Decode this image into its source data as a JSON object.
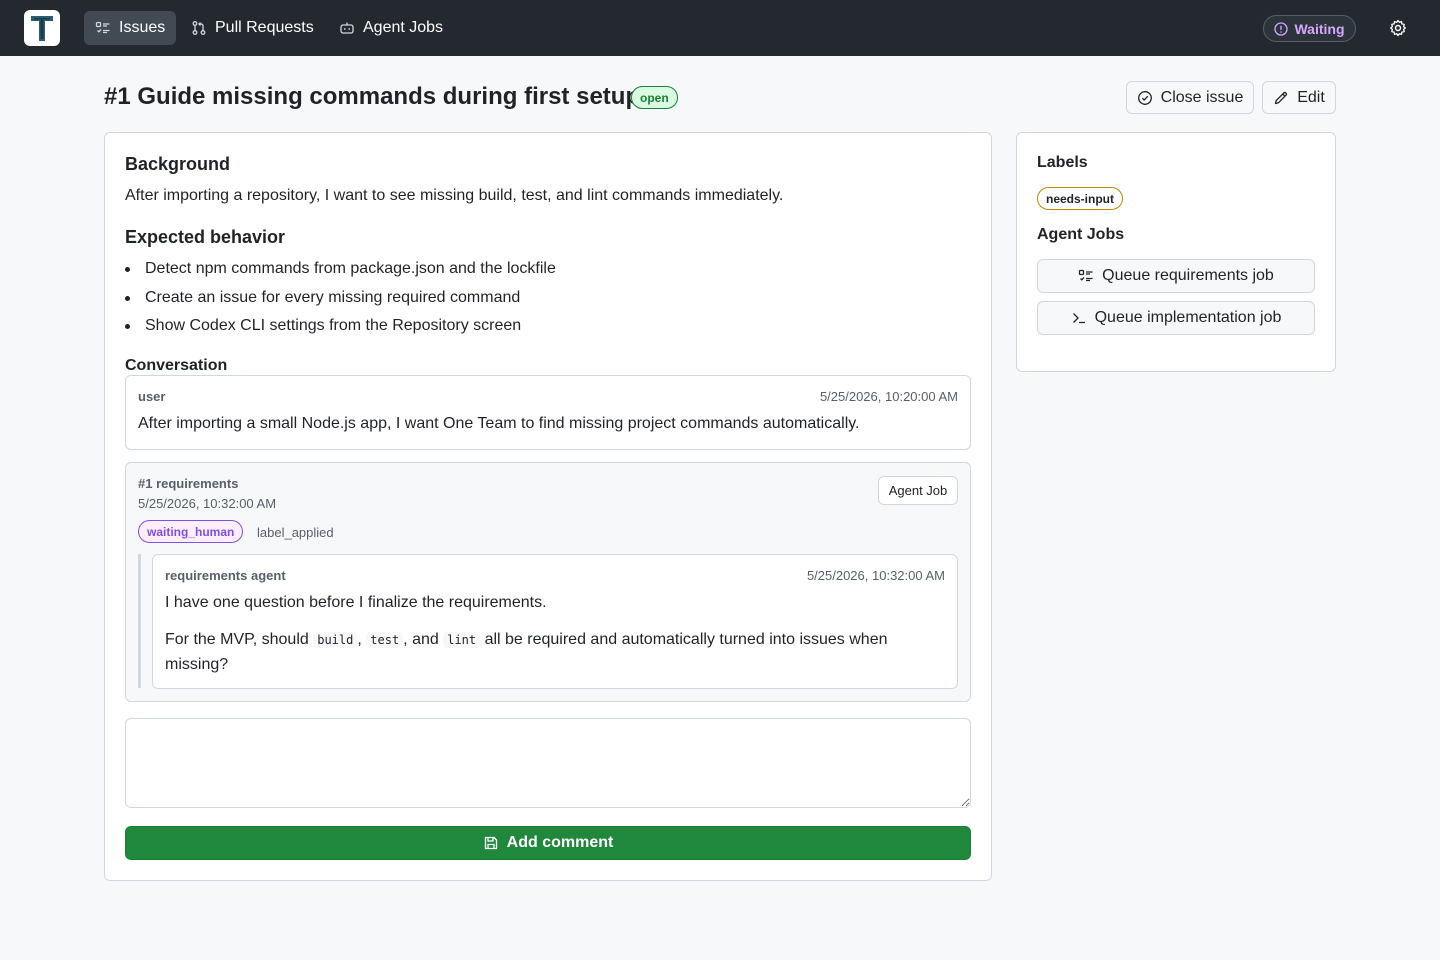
{
  "nav": {
    "items": [
      {
        "label": "Issues",
        "icon": "tasklist-icon",
        "active": true
      },
      {
        "label": "Pull Requests",
        "icon": "git-pull-request-icon",
        "active": false
      },
      {
        "label": "Agent Jobs",
        "icon": "robot-icon",
        "active": false
      }
    ],
    "status_label": "Waiting",
    "status_icon": "info-circle-icon"
  },
  "issue": {
    "title": "#1 Guide missing commands during first setup",
    "state": "open",
    "close_label": "Close issue",
    "edit_label": "Edit"
  },
  "body": {
    "background_heading": "Background",
    "background_text": "After importing a repository, I want to see missing build, test, and lint commands immediately.",
    "expected_heading": "Expected behavior",
    "expected_items": [
      "Detect npm commands from package.json and the lockfile",
      "Create an issue for every missing required command",
      "Show Codex CLI settings from the Repository screen"
    ]
  },
  "conversation": {
    "heading": "Conversation",
    "user_comment": {
      "author": "user",
      "timestamp": "5/25/2026, 10:20:00 AM",
      "text": "After importing a small Node.js app, I want One Team to find missing project commands automatically."
    },
    "job_event": {
      "title": "#1 requirements",
      "timestamp": "5/25/2026, 10:32:00 AM",
      "button_label": "Agent Job",
      "status_chip": "waiting_human",
      "event": "label_applied",
      "agent_comment": {
        "author": "requirements agent",
        "timestamp": "5/25/2026, 10:32:00 AM",
        "line1": "I have one question before I finalize the requirements.",
        "line2_prefix": "For the MVP, should",
        "code1": "build",
        "sep1": ",",
        "code2": "test",
        "sep2": ", and",
        "code3": "lint",
        "line2_suffix": "all be required and automatically turned into issues when",
        "line3": "missing?"
      }
    },
    "comment_placeholder": "",
    "add_comment_label": "Add comment"
  },
  "sidebar": {
    "labels_heading": "Labels",
    "labels": [
      "needs-input"
    ],
    "agent_jobs_heading": "Agent Jobs",
    "queue_requirements_label": "Queue requirements job",
    "queue_implementation_label": "Queue implementation job"
  },
  "colors": {
    "topbar": "#24292f",
    "accent_green": "#1f883d",
    "waiting_purple": "#8250df",
    "label_yellow": "#bf8700"
  }
}
